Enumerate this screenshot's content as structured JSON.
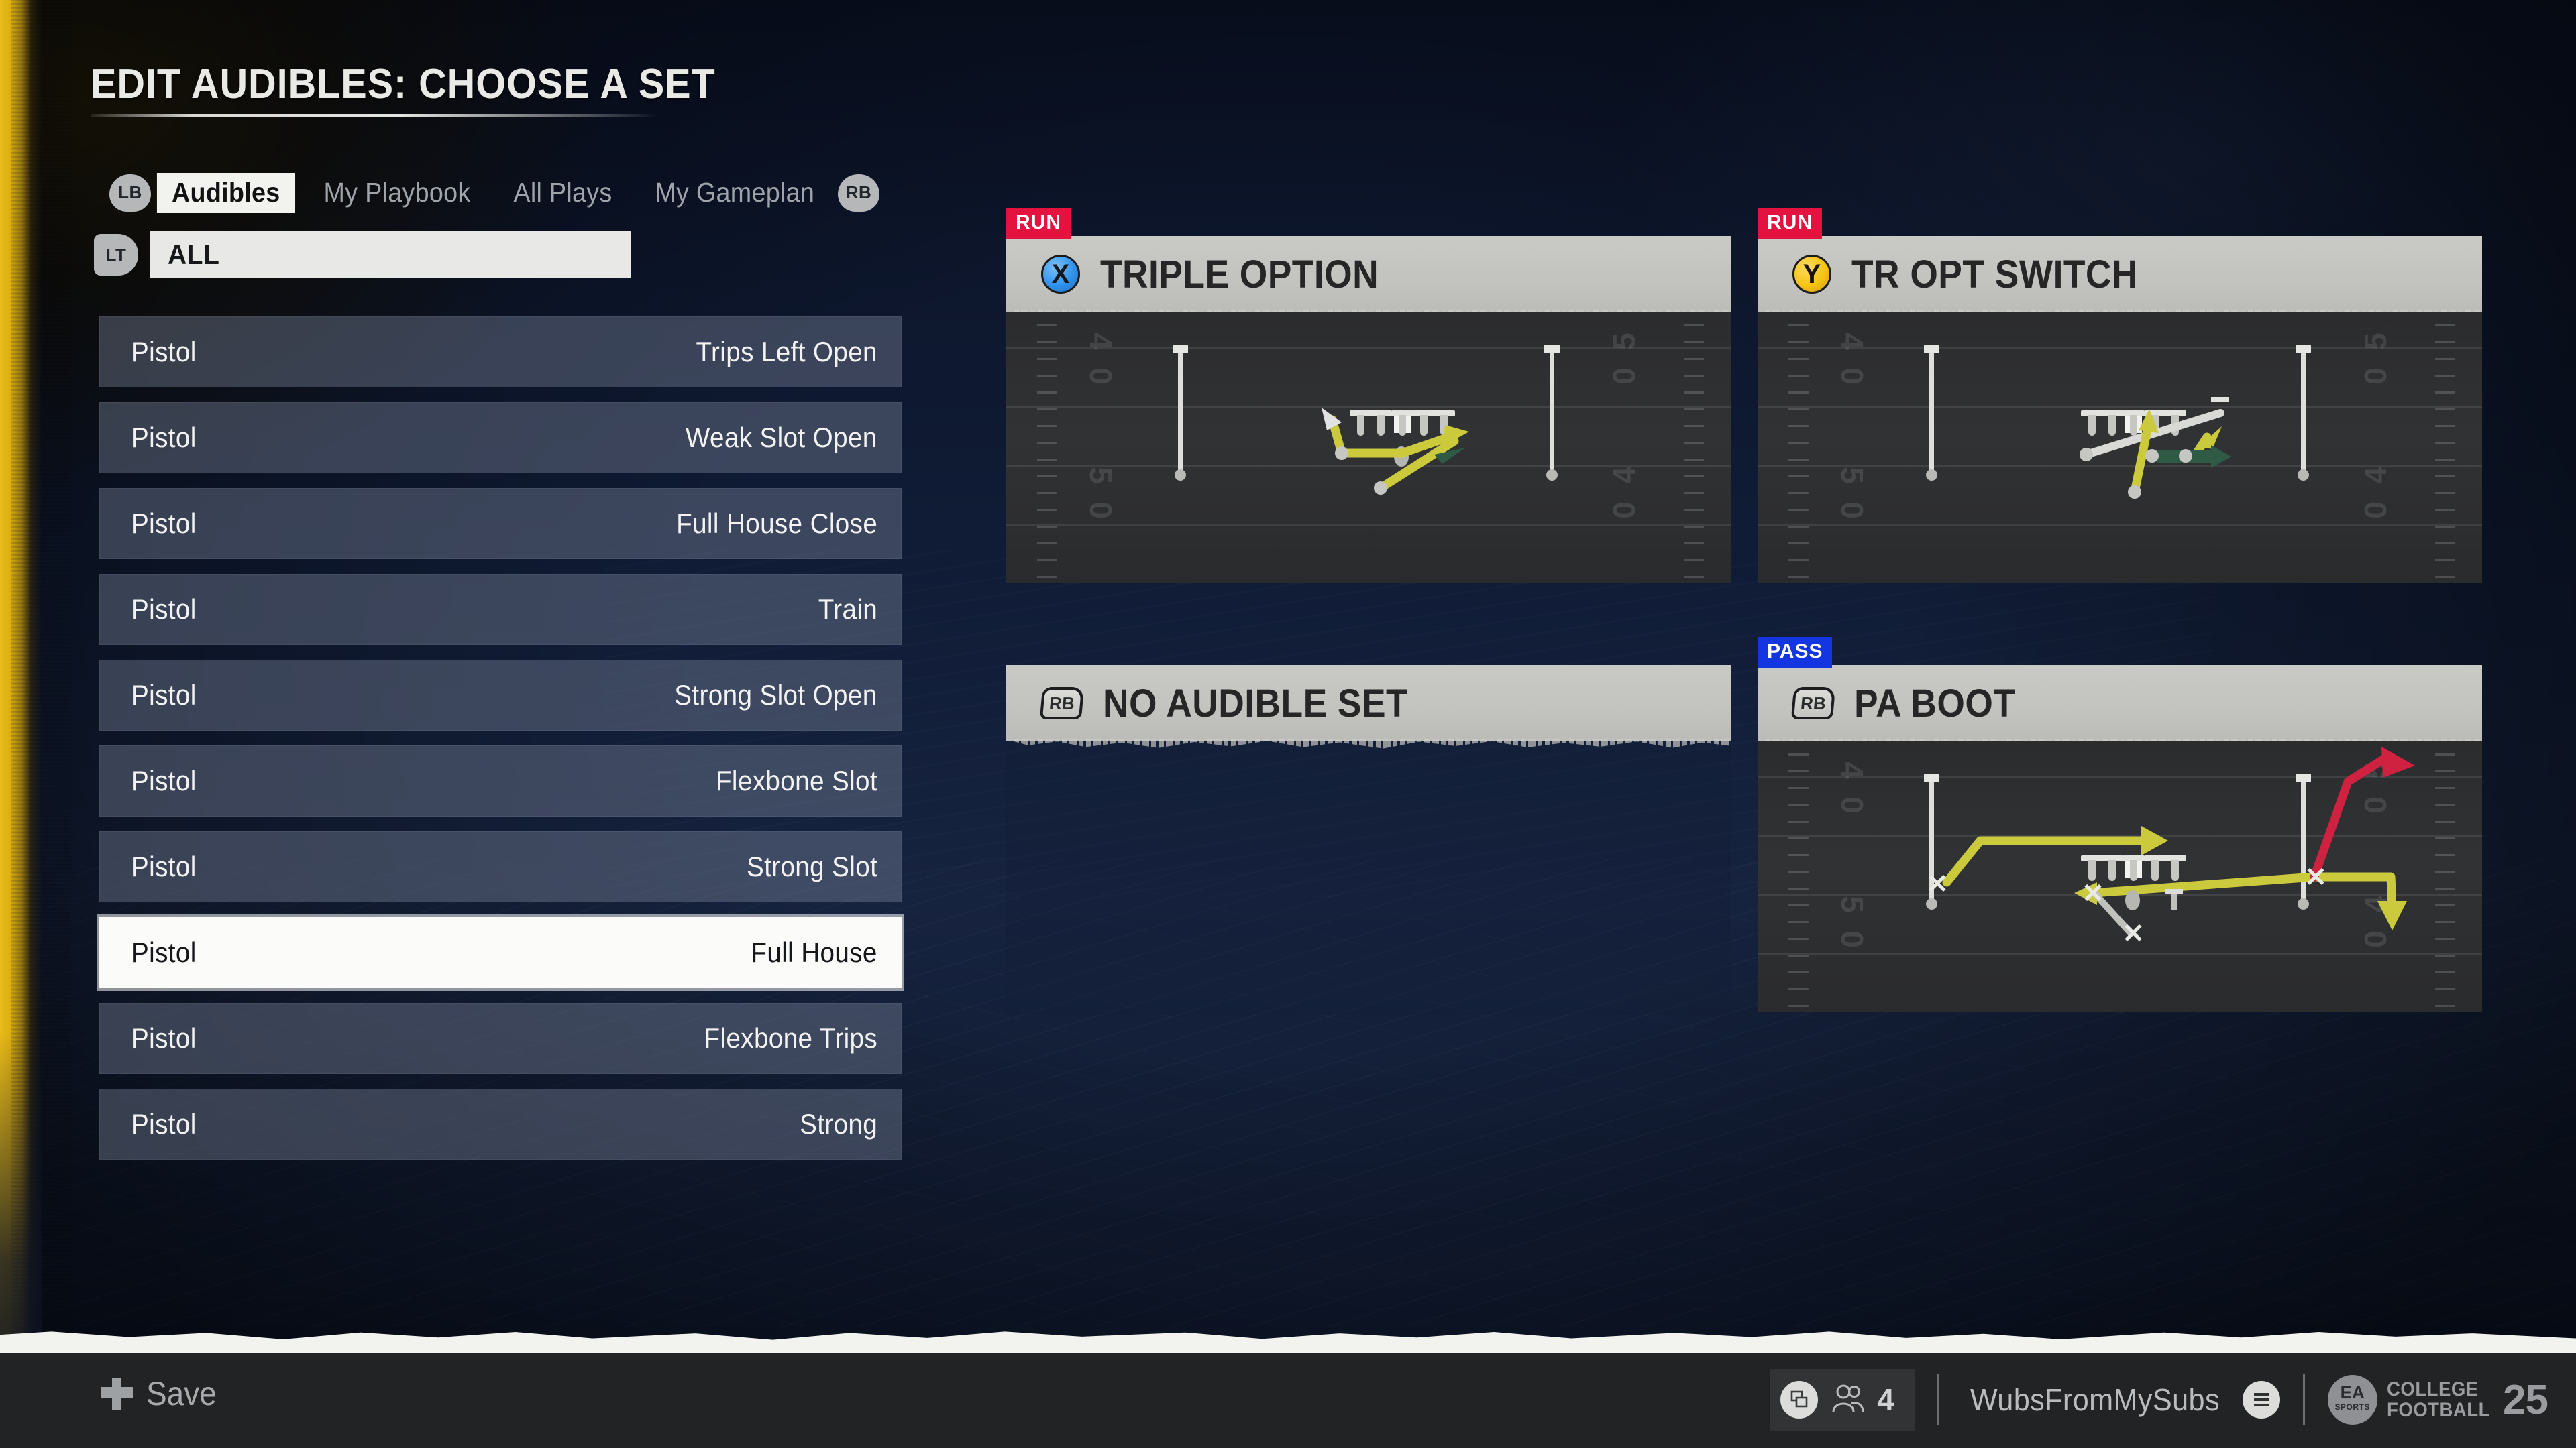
{
  "page": {
    "title": "EDIT AUDIBLES: CHOOSE A SET"
  },
  "tabs": {
    "left_bumper": "LB",
    "right_bumper": "RB",
    "items": [
      {
        "label": "Audibles",
        "active": true
      },
      {
        "label": "My Playbook",
        "active": false
      },
      {
        "label": "All Plays",
        "active": false
      },
      {
        "label": "My Gameplan",
        "active": false
      }
    ]
  },
  "filter": {
    "trigger": "LT",
    "value": "ALL"
  },
  "play_list": {
    "rows": [
      {
        "formation": "Pistol",
        "name": "Trips Left Open",
        "selected": false
      },
      {
        "formation": "Pistol",
        "name": "Weak Slot Open",
        "selected": false
      },
      {
        "formation": "Pistol",
        "name": "Full House Close",
        "selected": false
      },
      {
        "formation": "Pistol",
        "name": "Train",
        "selected": false
      },
      {
        "formation": "Pistol",
        "name": "Strong Slot Open",
        "selected": false
      },
      {
        "formation": "Pistol",
        "name": "Flexbone Slot",
        "selected": false
      },
      {
        "formation": "Pistol",
        "name": "Strong Slot",
        "selected": false
      },
      {
        "formation": "Pistol",
        "name": "Full House",
        "selected": true
      },
      {
        "formation": "Pistol",
        "name": "Flexbone Trips",
        "selected": false
      },
      {
        "formation": "Pistol",
        "name": "Strong",
        "selected": false
      }
    ]
  },
  "cards": [
    {
      "badge": "RUN",
      "badge_color": "#e4123e",
      "button": "X",
      "button_icon": "xbox-x-button-icon",
      "button_color": "#2f93ee",
      "title": "TRIPLE OPTION",
      "has_diagram": true
    },
    {
      "badge": "RUN",
      "badge_color": "#e4123e",
      "button": "Y",
      "button_icon": "xbox-y-button-icon",
      "button_color": "#f6c414",
      "title": "TR OPT SWITCH",
      "has_diagram": true
    },
    {
      "badge": "",
      "badge_color": "",
      "button": "RB",
      "button_icon": "rb-bumper-icon",
      "button_color": "#c4c5c1",
      "title": "NO AUDIBLE SET",
      "has_diagram": false
    },
    {
      "badge": "PASS",
      "badge_color": "#1436e0",
      "button": "RB",
      "button_icon": "rb-bumper-icon",
      "button_color": "#c4c5c1",
      "title": "PA BOOT",
      "has_diagram": true
    }
  ],
  "field": {
    "yard_numbers": [
      "4",
      "0",
      "5",
      "0",
      "5",
      "0",
      "4",
      "0"
    ]
  },
  "bottom_bar": {
    "save_label": "Save",
    "save_icon": "dpad-icon",
    "party_icon": "switch-profile-icon",
    "party_members_icon": "people-icon",
    "party_count": "4",
    "gamertag": "WubsFromMySubs",
    "menu_icon": "hamburger-menu-icon",
    "ea_sports_label": "EA",
    "ea_sports_sub": "SPORTS",
    "brand_line_1": "COLLEGE",
    "brand_line_2": "FOOTBALL",
    "brand_year": "25"
  }
}
